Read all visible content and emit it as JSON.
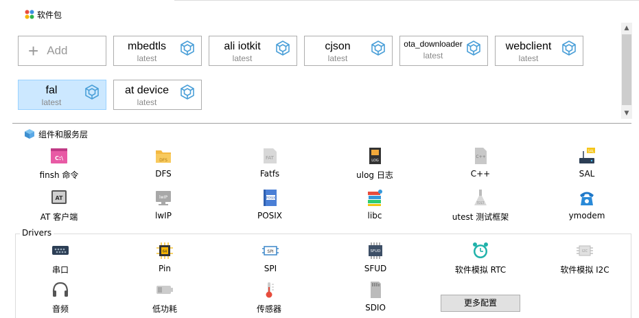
{
  "packages_header": {
    "title": "软件包",
    "icon": "colorful-dots-icon"
  },
  "add_button": {
    "label": "Add"
  },
  "packages": [
    {
      "name": "mbedtls",
      "version": "latest",
      "selected": false
    },
    {
      "name": "ali iotkit",
      "version": "latest",
      "selected": false
    },
    {
      "name": "cjson",
      "version": "latest",
      "selected": false
    },
    {
      "name": "ota_downloader",
      "version": "latest",
      "selected": false
    },
    {
      "name": "webclient",
      "version": "latest",
      "selected": false
    },
    {
      "name": "fal",
      "version": "latest",
      "selected": true
    },
    {
      "name": "at device",
      "version": "latest",
      "selected": false
    }
  ],
  "components_header": {
    "title": "组件和服务层",
    "icon": "cube-icon"
  },
  "components": [
    {
      "label": "finsh 命令",
      "icon": "terminal-icon"
    },
    {
      "label": "DFS",
      "icon": "folder-icon"
    },
    {
      "label": "Fatfs",
      "icon": "fat-drive-icon"
    },
    {
      "label": "ulog 日志",
      "icon": "log-book-icon"
    },
    {
      "label": "C++",
      "icon": "cpp-file-icon"
    },
    {
      "label": "SAL",
      "icon": "router-icon"
    },
    {
      "label": "AT 客户端",
      "icon": "at-monitor-icon"
    },
    {
      "label": "lwIP",
      "icon": "lwip-monitor-icon"
    },
    {
      "label": "POSIX",
      "icon": "posix-book-icon"
    },
    {
      "label": "libc",
      "icon": "books-icon"
    },
    {
      "label": "utest 测试框架",
      "icon": "test-flask-icon"
    },
    {
      "label": "ymodem",
      "icon": "phone-icon"
    }
  ],
  "drivers_title": "Drivers",
  "drivers": [
    {
      "label": "串口",
      "icon": "serial-port-icon"
    },
    {
      "label": "Pin",
      "icon": "chip-icon"
    },
    {
      "label": "SPI",
      "icon": "spi-chip-icon"
    },
    {
      "label": "SFUD",
      "icon": "sfud-chip-icon"
    },
    {
      "label": "软件模拟 RTC",
      "icon": "alarm-clock-icon"
    },
    {
      "label": "软件模拟 I2C",
      "icon": "i2c-chip-icon"
    },
    {
      "label": "音频",
      "icon": "headphones-icon"
    },
    {
      "label": "低功耗",
      "icon": "battery-icon"
    },
    {
      "label": "传感器",
      "icon": "thermometer-icon"
    },
    {
      "label": "SDIO",
      "icon": "sd-card-icon"
    }
  ],
  "more_button": {
    "label": "更多配置"
  },
  "colors": {
    "selected_card": "#cce8ff",
    "cube_blue": "#4a9fd8",
    "border": "#adadad"
  }
}
